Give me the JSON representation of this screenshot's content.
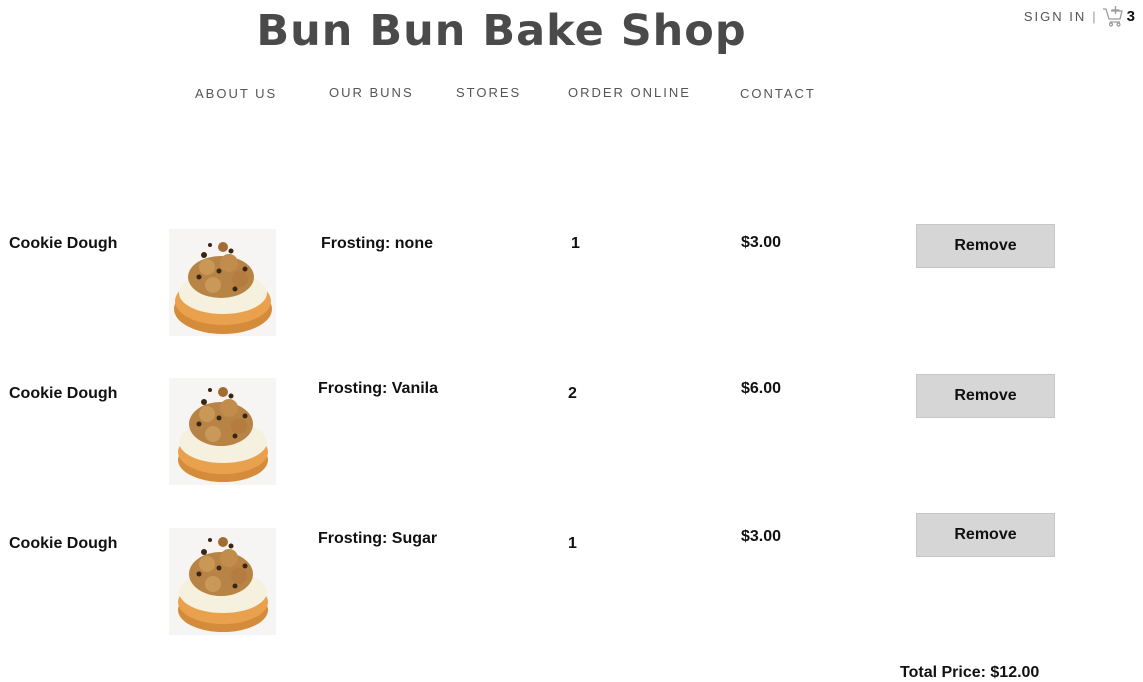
{
  "header": {
    "title": "Bun Bun Bake Shop",
    "sign_in": "SIGN IN",
    "separator": "|",
    "cart_count": "3",
    "cart_icon": "shopping-cart-plus-icon"
  },
  "nav": {
    "items": [
      {
        "label": "ABOUT US"
      },
      {
        "label": "OUR BUNS"
      },
      {
        "label": "STORES"
      },
      {
        "label": "ORDER ONLINE"
      },
      {
        "label": "CONTACT"
      }
    ]
  },
  "cart": {
    "items": [
      {
        "name": "Cookie Dough",
        "frosting": "Frosting: none",
        "quantity": "1",
        "price": "$3.00",
        "remove_label": "Remove"
      },
      {
        "name": "Cookie Dough",
        "frosting": "Frosting: Vanila",
        "quantity": "2",
        "price": "$6.00",
        "remove_label": "Remove"
      },
      {
        "name": "Cookie Dough",
        "frosting": "Frosting: Sugar",
        "quantity": "1",
        "price": "$3.00",
        "remove_label": "Remove"
      }
    ],
    "total": "Total Price: $12.00"
  }
}
